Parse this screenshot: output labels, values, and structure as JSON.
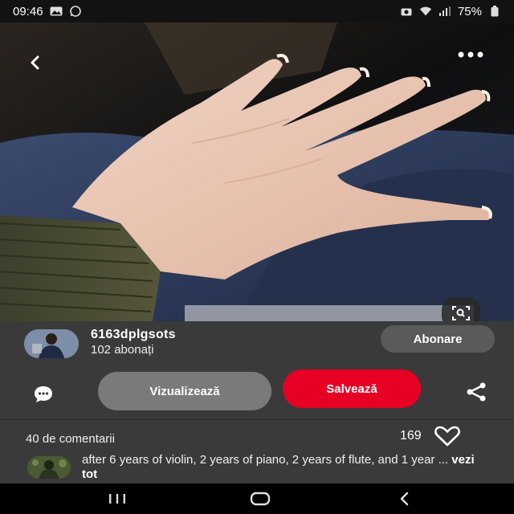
{
  "status_bar": {
    "time": "09:46",
    "battery": "75%"
  },
  "icons": {
    "back": "chevron-left-icon",
    "more": "more-horizontal-icon",
    "lens": "visual-search-icon",
    "comment": "comment-bubble-icon",
    "share": "share-icon",
    "heart": "heart-outline-icon"
  },
  "creator": {
    "name": "6163dplgsots",
    "followers": "102 abonați",
    "follow_label": "Abonare"
  },
  "actions": {
    "visit_label": "Vizualizează",
    "save_label": "Salvează"
  },
  "comments": {
    "count_label": "40 de comentarii",
    "likes": "169",
    "first_comment_text": "after 6 years of violin, 2 years of piano, 2 years of flute, and 1 year ...",
    "see_all_label": "vezi tot"
  },
  "colors": {
    "save_red": "#e60023",
    "sheet_bg": "#3a3a3a"
  }
}
